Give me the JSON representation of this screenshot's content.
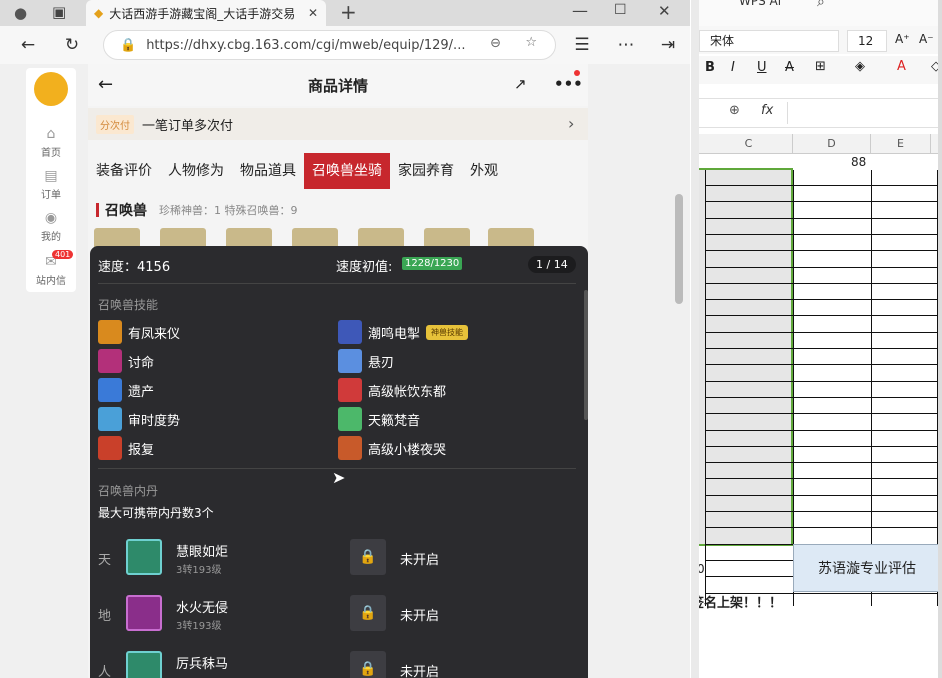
{
  "browser": {
    "tab_title": "大话西游手游藏宝阁_大话手游交易",
    "url": "https://dhxy.cbg.163.com/cgi/mweb/equip/129/..."
  },
  "left_nav": {
    "items": [
      {
        "label": "首页",
        "icon": "home-icon"
      },
      {
        "label": "订单",
        "icon": "order-icon"
      },
      {
        "label": "我的",
        "icon": "user-icon"
      },
      {
        "label": "站内信",
        "icon": "mail-icon",
        "badge": "401"
      }
    ]
  },
  "mobile": {
    "header_title": "商品详情",
    "pay_tag": "分次付",
    "pay_text": "一笔订单多次付",
    "tabs": [
      "装备评价",
      "人物修为",
      "物品道具",
      "召唤兽坐骑",
      "家园养育",
      "外观"
    ],
    "active_tab": "召唤兽坐骑",
    "beast_title": "召唤兽",
    "beast_stats": "珍稀神兽：1   特殊召唤兽：9"
  },
  "popup": {
    "speed_label": "速度：4156",
    "speed_init_label": "速度初值:",
    "speed_init_value": "1228/1230",
    "page_counter": "1 / 14",
    "skills_title": "召唤兽技能",
    "skills_left": [
      "有凤来仪",
      "讨命",
      "遗产",
      "审时度势",
      "报复"
    ],
    "skills_right": [
      "潮鸣电掣",
      "悬刃",
      "高级帐饮东都",
      "天籁梵音",
      "高级小楼夜哭"
    ],
    "badge_text": "神兽技能",
    "inner_title": "召唤兽内丹",
    "inner_subtitle": "最大可携带内丹数3个",
    "dan": [
      {
        "slot": "天",
        "name": "慧眼如炬",
        "level": "3转193级",
        "locked": "未开启"
      },
      {
        "slot": "地",
        "name": "水火无侵",
        "level": "3转193级",
        "locked": "未开启"
      },
      {
        "slot": "人",
        "name": "厉兵秣马",
        "level": "",
        "locked": "未开启"
      }
    ]
  },
  "sheet": {
    "app_name": "WPS Al",
    "font_name": "宋体",
    "font_size": "12",
    "formula_fx": "fx",
    "columns": [
      "C",
      "D",
      "E"
    ],
    "d_value": "88",
    "zero_value": "0",
    "box_text": "苏语漩专业评估",
    "bottom_text": "签名上架！！！"
  }
}
